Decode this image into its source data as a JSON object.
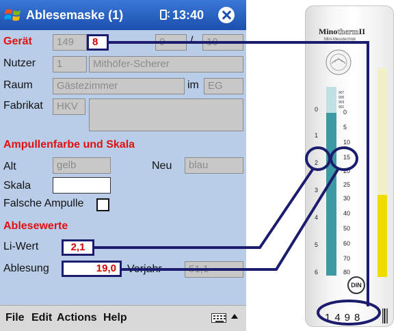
{
  "title_bar": {
    "title": "Ablesemaske (1)",
    "time": "13:40",
    "icons": [
      "windows-logo-icon",
      "sync-icon",
      "close-icon"
    ]
  },
  "geraet": {
    "label": "Gerät",
    "value1": "149",
    "value2": "8",
    "value3": "9",
    "separator": "/",
    "value4": "10"
  },
  "nutzer": {
    "label": "Nutzer",
    "number": "1",
    "name": "Mithöfer-Scherer"
  },
  "raum": {
    "label": "Raum",
    "value": "Gästezimmer",
    "im_label": "im",
    "floor": "EG"
  },
  "fabrikat": {
    "label": "Fabrikat",
    "value": "HKV",
    "description": ""
  },
  "section_ampulle": {
    "heading": "Ampullenfarbe und Skala",
    "alt_label": "Alt",
    "alt_value": "gelb",
    "neu_label": "Neu",
    "neu_value": "blau",
    "skala_label": "Skala",
    "skala_value": "",
    "falsche_label": "Falsche Ampulle"
  },
  "section_ablese": {
    "heading": "Ablesewerte",
    "liwert_label": "Li-Wert",
    "liwert_value": "2,1",
    "ablesung_label": "Ablesung",
    "ablesung_value": "19,0",
    "vorjahr_label": "Vorjahr",
    "vorjahr_value": "51,1"
  },
  "menu": {
    "items": [
      "File",
      "Edit",
      "Actions",
      "Help"
    ]
  },
  "meter": {
    "brand_bold": "Mino",
    "brand_outline": "therm",
    "brand_suffix": "II",
    "brand_sub": "Mini-Messtechnik",
    "serial": "1498",
    "din": "DIN",
    "small_marks": [
      "907",
      "905",
      "903",
      "901"
    ],
    "left_scale": [
      "0",
      "1",
      "2",
      "3",
      "4",
      "5",
      "6"
    ],
    "right_scale": [
      "0",
      "5",
      "10",
      "15",
      "20",
      "25",
      "30",
      "40",
      "50",
      "60",
      "70",
      "80"
    ]
  },
  "colors": {
    "titlebar": "#1b4fae",
    "form_bg": "#b9cde8",
    "section_red": "#e01010",
    "highlight_border": "#1c1c6e",
    "tube_blue": "#3c9aa2",
    "tube_yellow": "#f1dc00"
  }
}
